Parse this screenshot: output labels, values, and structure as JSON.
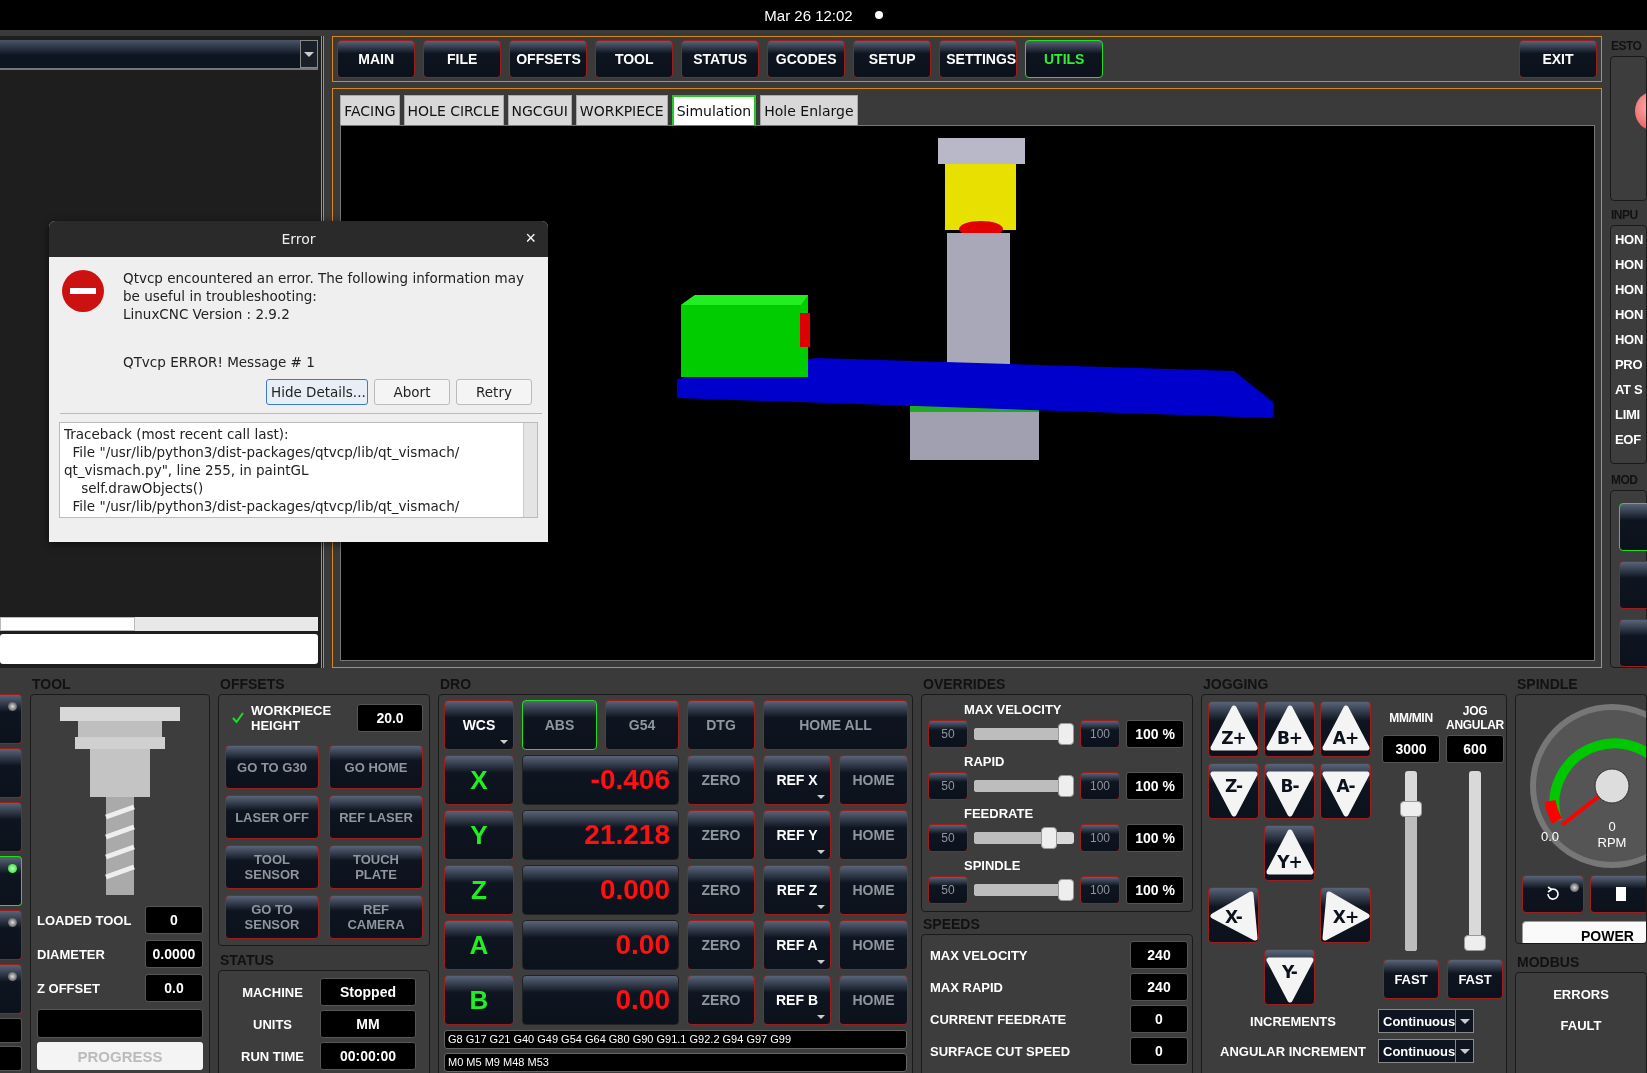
{
  "top_bar": {
    "clock": "Mar 26  12:02"
  },
  "nav_buttons": [
    {
      "label": "MAIN",
      "selected": false
    },
    {
      "label": "FILE",
      "selected": false
    },
    {
      "label": "OFFSETS",
      "selected": false
    },
    {
      "label": "TOOL",
      "selected": false
    },
    {
      "label": "STATUS",
      "selected": false
    },
    {
      "label": "GCODES",
      "selected": false
    },
    {
      "label": "SETUP",
      "selected": false
    },
    {
      "label": "SETTINGS",
      "selected": false
    },
    {
      "label": "UTILS",
      "selected": true
    }
  ],
  "exit_button": "EXIT",
  "util_tabs": [
    {
      "label": "FACING",
      "selected": false
    },
    {
      "label": "HOLE CIRCLE",
      "selected": false
    },
    {
      "label": "NGCGUI",
      "selected": false
    },
    {
      "label": "WORKPIECE",
      "selected": false
    },
    {
      "label": "Simulation",
      "selected": true
    },
    {
      "label": "Hole Enlarge",
      "selected": false
    }
  ],
  "error_dialog": {
    "title": "Error",
    "close": "×",
    "message": [
      "Qtvcp encountered an error.  The following information may be useful in troubleshooting:",
      "LinuxCNC Version  : 2.9.2"
    ],
    "error_line": "QTvcp ERROR! Message # 1",
    "buttons": [
      {
        "label": "Hide Details...",
        "focused": true
      },
      {
        "label": "Abort",
        "focused": false
      },
      {
        "label": "Retry",
        "focused": false
      }
    ],
    "details": [
      "Traceback (most recent call last):",
      "  File \"/usr/lib/python3/dist-packages/qtvcp/lib/qt_vismach/",
      "qt_vismach.py\", line 255, in paintGL",
      "    self.drawObjects()",
      "  File \"/usr/lib/python3/dist-packages/qtvcp/lib/qt_vismach/"
    ]
  },
  "right_strip": {
    "estop_heading": "ESTO",
    "inputs_heading": "INPU",
    "inputs": [
      "HON",
      "HON",
      "HON",
      "HON",
      "HON",
      "PRO",
      "AT S",
      "LIMI",
      "EOF"
    ],
    "modes_heading": "MOD",
    "mode_buttons": [
      {
        "selected": true
      },
      {
        "selected": false
      },
      {
        "selected": false
      }
    ]
  },
  "left_strip": [
    {
      "kind": "led",
      "on": false
    },
    {
      "kind": "plain",
      "on": false
    },
    {
      "kind": "plain",
      "on": false
    },
    {
      "kind": "led",
      "on": true
    },
    {
      "kind": "led",
      "on": false
    },
    {
      "kind": "led",
      "on": false
    }
  ],
  "tool": {
    "heading": "TOOL",
    "fields": [
      {
        "label": "LOADED TOOL",
        "value": "0"
      },
      {
        "label": "DIAMETER",
        "value": "0.0000"
      },
      {
        "label": "Z OFFSET",
        "value": "0.0"
      }
    ],
    "progress": {
      "label": "PROGRESS",
      "level": 0
    }
  },
  "offsets": {
    "heading": "OFFSETS",
    "workpiece": {
      "label": "WORKPIECE HEIGHT",
      "checked": true,
      "value": "20.0"
    },
    "buttons": [
      {
        "label": "GO TO G30",
        "disabled": true
      },
      {
        "label": "GO HOME",
        "disabled": true
      },
      {
        "label": "LASER OFF",
        "disabled": true
      },
      {
        "label": "REF LASER",
        "disabled": true
      },
      {
        "label": "TOOL SENSOR",
        "disabled": true
      },
      {
        "label": "TOUCH PLATE",
        "disabled": true
      },
      {
        "label": "GO TO SENSOR",
        "disabled": true
      },
      {
        "label": "REF CAMERA",
        "disabled": true
      }
    ]
  },
  "status": {
    "heading": "STATUS",
    "rows": [
      {
        "label": "MACHINE",
        "value": "Stopped"
      },
      {
        "label": "UNITS",
        "value": "MM"
      },
      {
        "label": "RUN TIME",
        "value": "00:00:00"
      }
    ]
  },
  "dro": {
    "heading": "DRO",
    "top_buttons": [
      {
        "label": "WCS",
        "disabled": false,
        "selected": false,
        "menu": true
      },
      {
        "label": "ABS",
        "disabled": true,
        "selected": true,
        "menu": false
      },
      {
        "label": "G54",
        "disabled": true,
        "selected": false,
        "menu": false
      },
      {
        "label": "DTG",
        "disabled": true,
        "selected": false,
        "menu": false
      },
      {
        "label": "HOME ALL",
        "disabled": true,
        "selected": false,
        "menu": false
      }
    ],
    "axes": [
      {
        "axis": "X",
        "value": "-0.406",
        "zero": "ZERO",
        "ref": "REF X",
        "home": "HOME"
      },
      {
        "axis": "Y",
        "value": "21.218",
        "zero": "ZERO",
        "ref": "REF Y",
        "home": "HOME"
      },
      {
        "axis": "Z",
        "value": "0.000",
        "zero": "ZERO",
        "ref": "REF Z",
        "home": "HOME"
      },
      {
        "axis": "A",
        "value": "0.00",
        "zero": "ZERO",
        "ref": "REF A",
        "home": "HOME"
      },
      {
        "axis": "B",
        "value": "0.00",
        "zero": "ZERO",
        "ref": "REF B",
        "home": "HOME"
      }
    ],
    "gcodes": "G8 G17 G21 G40 G49 G54 G64 G80 G90 G91.1 G92.2 G94 G97 G99",
    "mcodes": "M0 M5 M9 M48 M53"
  },
  "overrides": {
    "heading": "OVERRIDES",
    "sliders": [
      {
        "label": "MAX VELOCITY",
        "min": "50",
        "max": "100",
        "reading": "100 %",
        "level": 1
      },
      {
        "label": "RAPID",
        "min": "50",
        "max": "100",
        "reading": "100 %",
        "level": 1
      },
      {
        "label": "FEEDRATE",
        "min": "50",
        "max": "100",
        "reading": "100 %",
        "level": 0.8
      },
      {
        "label": "SPINDLE",
        "min": "50",
        "max": "100",
        "reading": "100 %",
        "level": 1
      }
    ]
  },
  "speeds": {
    "heading": "SPEEDS",
    "rows": [
      {
        "label": "MAX VELOCITY",
        "value": "240"
      },
      {
        "label": "MAX RAPID",
        "value": "240"
      },
      {
        "label": "CURRENT FEEDRATE",
        "value": "0"
      },
      {
        "label": "SURFACE CUT SPEED",
        "value": "0"
      }
    ]
  },
  "jogging": {
    "heading": "JOGGING",
    "buttons": [
      {
        "label": "Z+",
        "kind": "up"
      },
      {
        "label": "B+",
        "kind": "up"
      },
      {
        "label": "A+",
        "kind": "up"
      },
      {
        "label": "Z-",
        "kind": "down"
      },
      {
        "label": "B-",
        "kind": "down"
      },
      {
        "label": "A-",
        "kind": "down"
      },
      {
        "label": "Y+",
        "kind": "up"
      },
      {
        "label": "X-",
        "kind": "left"
      },
      {
        "label": "X+",
        "kind": "right"
      },
      {
        "label": "Y-",
        "kind": "down"
      }
    ],
    "rates": [
      {
        "label": "MM/MIN",
        "value": "3000",
        "level": 0.82,
        "fast": "FAST"
      },
      {
        "label": "JOG ANGULAR",
        "value": "600",
        "level": 0,
        "fast": "FAST"
      }
    ],
    "increments": [
      {
        "label": "INCREMENTS",
        "value": "Continuous"
      },
      {
        "label": "ANGULAR INCREMENT",
        "value": "Continuous"
      }
    ]
  },
  "spindle": {
    "heading": "SPINDLE",
    "gauge_min": "0.0",
    "rpm": "0",
    "unit": "RPM",
    "power": "POWER"
  },
  "modbus": {
    "heading": "MODBUS",
    "labels": [
      "ERRORS",
      "FAULT"
    ]
  }
}
